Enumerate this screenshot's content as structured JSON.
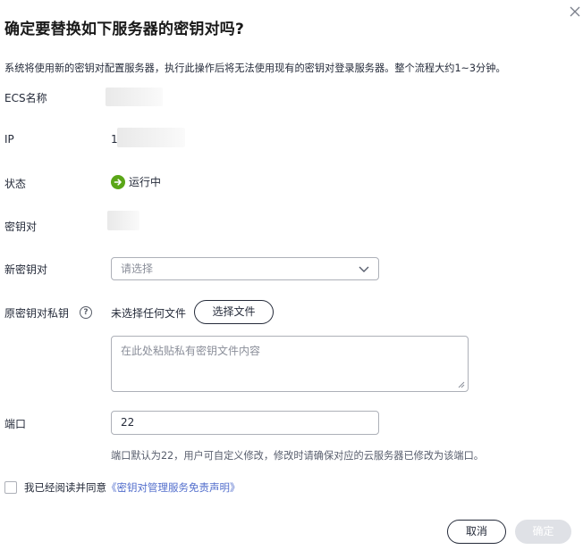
{
  "dialog": {
    "title": "确定要替换如下服务器的密钥对吗?",
    "description": "系统将使用新的密钥对配置服务器，执行此操作后将无法使用现有的密钥对登录服务器。整个流程大约1~3分钟。"
  },
  "fields": {
    "ecs_name_label": "ECS名称",
    "ip_label": "IP",
    "ip_value_prefix": "1",
    "status_label": "状态",
    "status_value": "运行中",
    "keypair_label": "密钥对",
    "new_keypair_label": "新密钥对",
    "new_keypair_placeholder": "请选择",
    "private_key_label": "原密钥对私钥",
    "help_glyph": "?",
    "no_file_text": "未选择任何文件",
    "choose_file_label": "选择文件",
    "private_key_placeholder": "在此处粘贴私有密钥文件内容",
    "port_label": "端口",
    "port_value": "22",
    "port_hint": "端口默认为22，用户可自定义修改，修改时请确保对应的云服务器已修改为该端口。"
  },
  "agreement": {
    "prefix": "我已经阅读并同意",
    "link": "《密钥对管理服务免责声明》"
  },
  "buttons": {
    "cancel": "取消",
    "confirm": "确定"
  },
  "colors": {
    "status_running": "#5aa617",
    "link": "#526ecc",
    "disabled_button": "#dfe1e6"
  },
  "icons": {
    "close": "close-icon",
    "status": "arrow-right-circle-icon",
    "select": "chevron-down-icon",
    "help": "question-circle-icon"
  }
}
